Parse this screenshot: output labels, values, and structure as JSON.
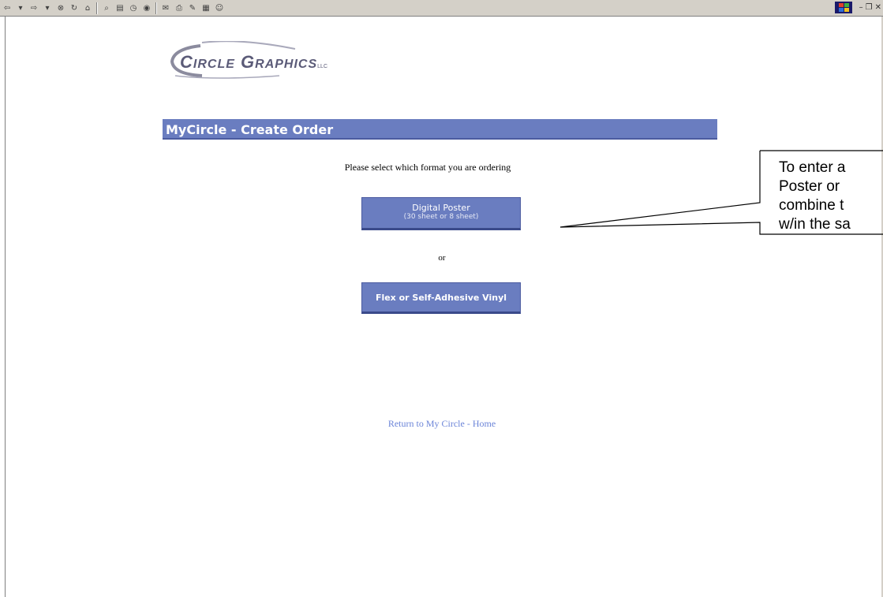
{
  "toolbar": {
    "icons": [
      "back-icon",
      "dropdown-icon",
      "forward-icon",
      "dropdown-icon",
      "stop-icon",
      "refresh-icon",
      "home-icon",
      "search-icon",
      "favorites-icon",
      "history-icon",
      "media-icon",
      "mail-icon",
      "print-icon",
      "edit-icon",
      "discuss-icon",
      "messenger-icon"
    ],
    "window_controls": {
      "minimize": "–",
      "restore": "❐",
      "close": "✕"
    }
  },
  "logo": {
    "text_c": "C",
    "text_ircle": "IRCLE",
    "text_g": "G",
    "text_raphics": "RAPHICS",
    "llc": "LLC"
  },
  "title_bar": {
    "label": "MyCircle - Create Order"
  },
  "prompt": "Please select which format you are ordering",
  "buttons": {
    "digital_main": "Digital Poster",
    "digital_sub": "(30 sheet or 8 sheet)",
    "or": "or",
    "flex": "Flex or Self-Adhesive Vinyl"
  },
  "return_link": "Return to My Circle - Home",
  "callout": {
    "lines": [
      "To enter a",
      "Poster or",
      "combine t",
      "w/in the sa"
    ]
  },
  "colors": {
    "accent": "#6a7dc0",
    "link": "#6b84d8",
    "logo": "#5b5b78"
  }
}
